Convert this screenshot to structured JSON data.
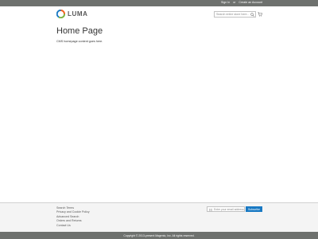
{
  "header": {
    "top_links": {
      "sign_in": "Sign In",
      "separator": "or",
      "create_account": "Create an Account"
    },
    "logo_text": "LUMA",
    "search": {
      "placeholder": "Search entire store here...",
      "value": ""
    }
  },
  "main": {
    "title": "Home Page",
    "cms_text": "CMS homepage content goes here."
  },
  "footer": {
    "links": [
      "Search Terms",
      "Privacy and Cookie Policy",
      "Advanced Search",
      "Orders and Returns",
      "Contact Us"
    ],
    "newsletter": {
      "placeholder": "Enter your email address",
      "button_label": "Subscribe"
    },
    "copyright": "Copyright © 2013-present Magento, Inc. All rights reserved."
  },
  "colors": {
    "header_bar": "#6e716e",
    "footer_bg": "#f4f4f4",
    "accent": "#1979c3",
    "logo_orange": "#f26322",
    "logo_green": "#7cb342",
    "logo_blue": "#1979c3"
  },
  "icons": {
    "logo": "luma-logo-icon",
    "search": "search-icon",
    "cart": "cart-icon",
    "mail": "mail-icon"
  }
}
